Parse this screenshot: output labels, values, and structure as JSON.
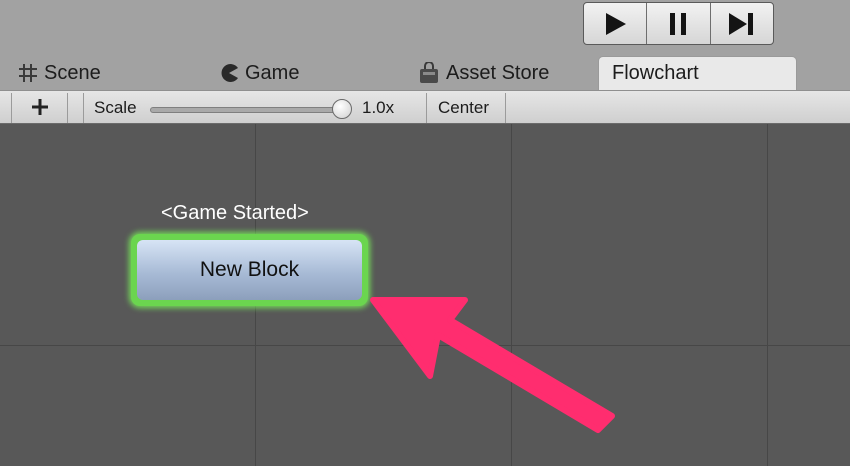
{
  "play_controls": {
    "icons": [
      "play-icon",
      "pause-icon",
      "step-icon"
    ]
  },
  "tabs": [
    {
      "label": "Scene",
      "icon": "grid-icon",
      "active": false
    },
    {
      "label": "Game",
      "icon": "pacman-icon",
      "active": false
    },
    {
      "label": "Asset Store",
      "icon": "shopping-bag-icon",
      "active": false
    },
    {
      "label": "Flowchart",
      "icon": "",
      "active": true
    }
  ],
  "toolbar": {
    "add_icon": "plus-icon",
    "scale_label": "Scale",
    "scale_value_text": "1.0x",
    "scale_value": 1.0,
    "center_label": "Center"
  },
  "canvas": {
    "event_label": "<Game Started>",
    "block_label": "New Block",
    "accent_glow": "#6bd54f",
    "annotation_arrow_color": "#ff2d6f"
  }
}
